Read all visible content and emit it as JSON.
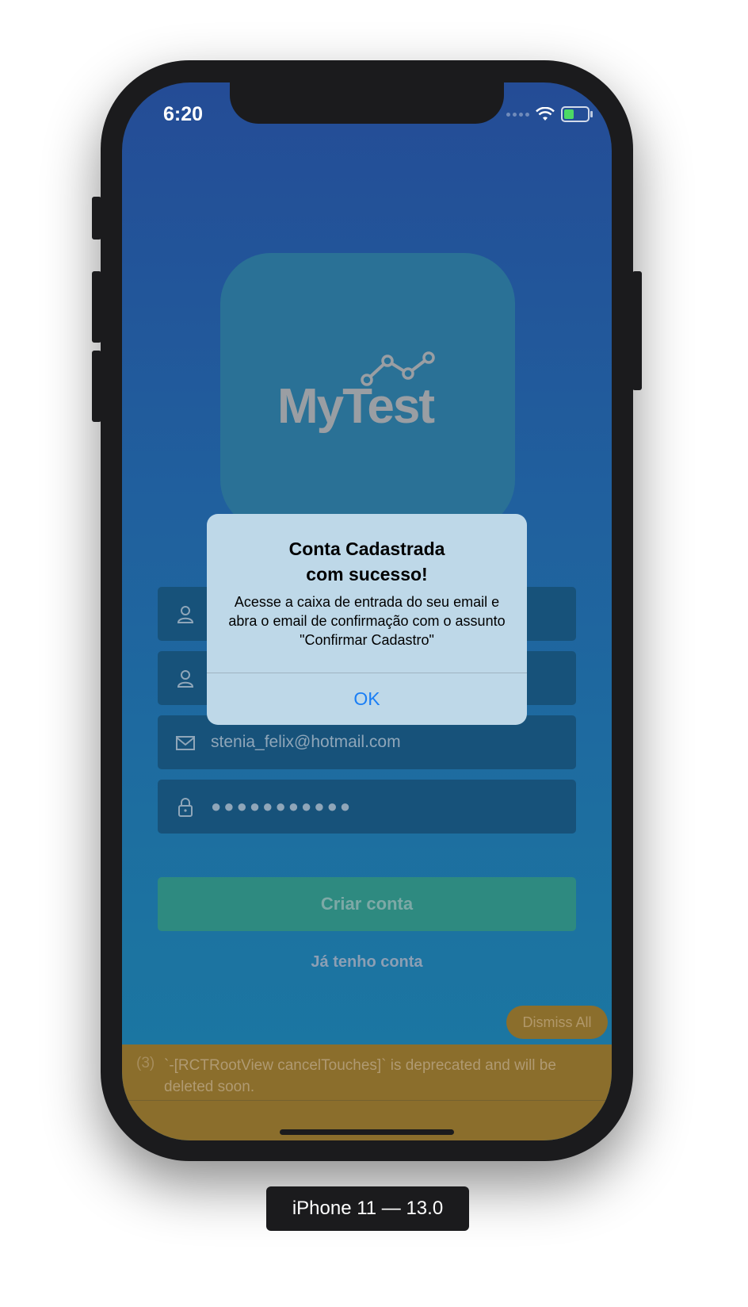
{
  "status_bar": {
    "time": "6:20"
  },
  "logo": {
    "text": "MyTest"
  },
  "form": {
    "email_value": "stenia_felix@hotmail.com",
    "password_value": "●●●●●●●●●●●",
    "submit_label": "Criar conta",
    "login_link": "Já tenho conta"
  },
  "alert": {
    "title": "Conta Cadastrada\ncom sucesso!",
    "message": "Acesse a caixa de entrada do seu email e abra o email de confirmação com o assunto \"Confirmar Cadastro\"",
    "ok_label": "OK"
  },
  "dev_logbox": {
    "dismiss_label": "Dismiss All",
    "count": "(3)",
    "message": "`-[RCTRootView cancelTouches]` is deprecated and will be deleted soon."
  },
  "simulator": {
    "device_label": "iPhone 11 — 13.0"
  },
  "colors": {
    "accent": "#1a7ef5",
    "warning": "#8b6e2c",
    "primary_bg": "#244c96"
  }
}
